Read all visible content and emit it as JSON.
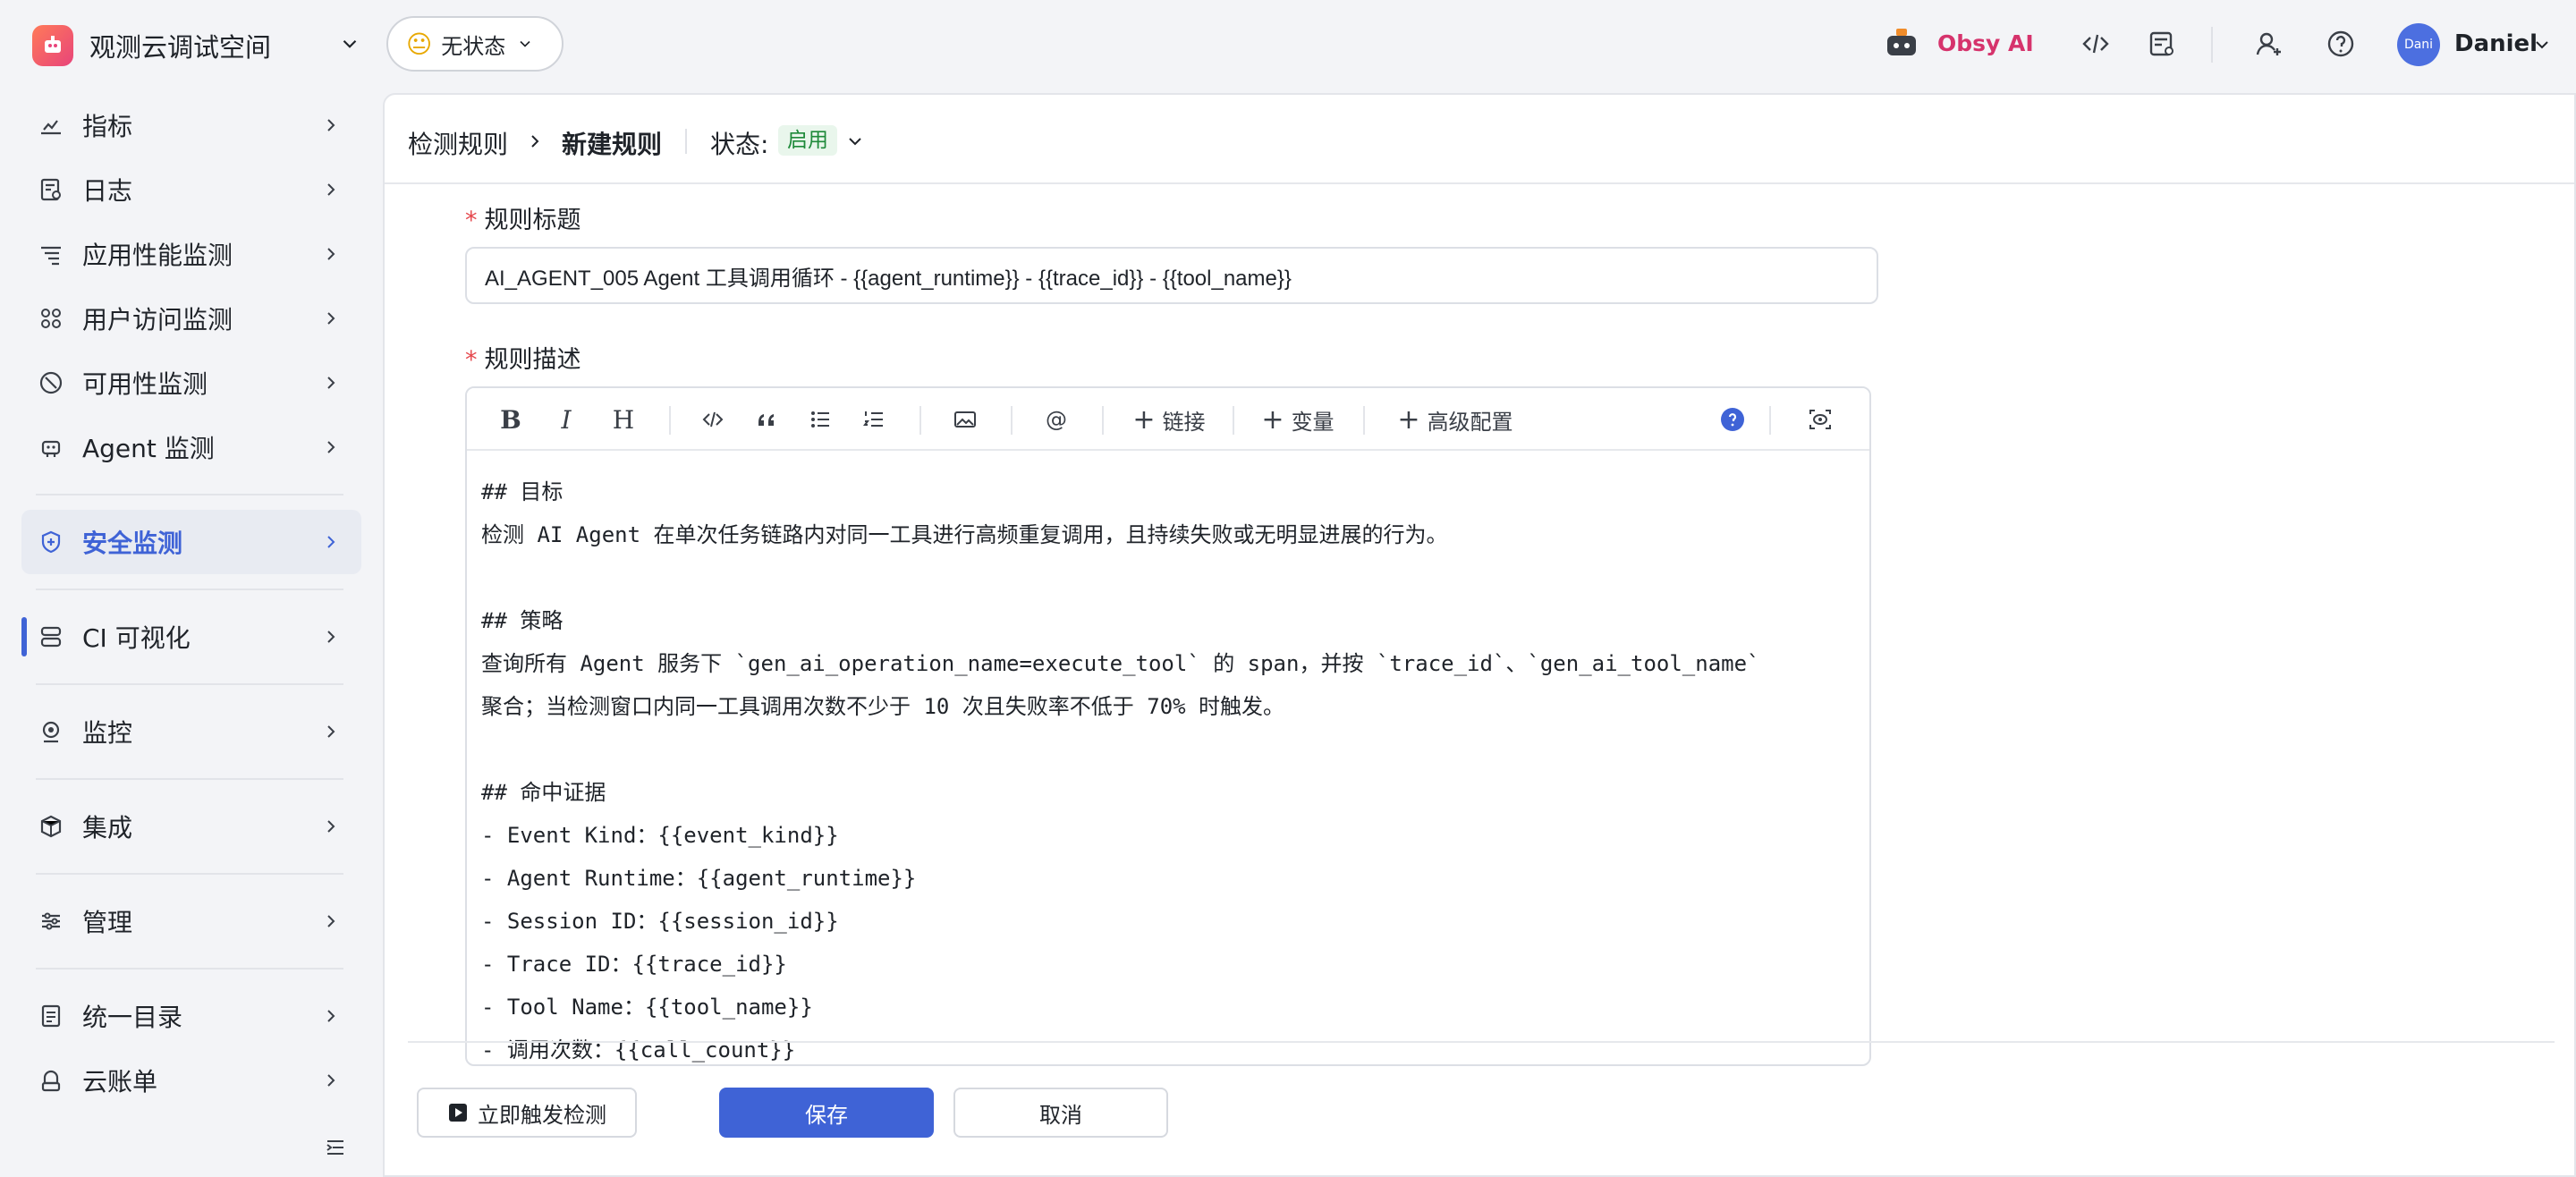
{
  "topbar": {
    "workspace_name": "观测云调试空间",
    "status_label": "无状态",
    "status_emoji": "😐",
    "ai_label": "Obsy AI",
    "avatar_text": "Dani",
    "user_name": "Daniel"
  },
  "sidebar": {
    "items": [
      {
        "label": "指标",
        "icon": "chart-icon"
      },
      {
        "label": "日志",
        "icon": "log-icon"
      },
      {
        "label": "应用性能监测",
        "icon": "apm-icon"
      },
      {
        "label": "用户访问监测",
        "icon": "grid-icon"
      },
      {
        "label": "可用性监测",
        "icon": "dial-icon"
      },
      {
        "label": "Agent 监测",
        "icon": "robot-icon"
      },
      {
        "label": "安全监测",
        "icon": "shield-icon",
        "active": true
      },
      {
        "label": "CI 可视化",
        "icon": "pipeline-icon"
      },
      {
        "label": "监控",
        "icon": "camera-icon"
      },
      {
        "label": "集成",
        "icon": "cube-icon"
      },
      {
        "label": "管理",
        "icon": "sliders-icon"
      },
      {
        "label": "统一目录",
        "icon": "catalog-icon"
      },
      {
        "label": "云账单",
        "icon": "bill-icon"
      }
    ]
  },
  "header": {
    "crumb_parent": "检测规则",
    "crumb_current": "新建规则",
    "state_label": "状态:",
    "state_value": "启用"
  },
  "form": {
    "title_label": "规则标题",
    "title_value": "AI_AGENT_005 Agent 工具调用循环 - {{agent_runtime}} - {{trace_id}} - {{tool_name}}",
    "desc_label": "规则描述",
    "toolbar": {
      "bold": "B",
      "italic": "I",
      "heading": "H",
      "mention": "@",
      "link": "链接",
      "variable": "变量",
      "advanced": "高级配置"
    },
    "content_lines": [
      "## 目标",
      "检测 AI Agent 在单次任务链路内对同一工具进行高频重复调用，且持续失败或无明显进展的行为。",
      "",
      "## 策略",
      "查询所有 Agent 服务下 `gen_ai_operation_name=execute_tool` 的 span，并按 `trace_id`、`gen_ai_tool_name`",
      "聚合；当检测窗口内同一工具调用次数不少于 10 次且失败率不低于 70% 时触发。",
      "",
      "## 命中证据",
      "- Event Kind：{{event_kind}}",
      "- Agent Runtime：{{agent_runtime}}",
      "- Session ID：{{session_id}}",
      "- Trace ID：{{trace_id}}",
      "- Tool Name：{{tool_name}}",
      "- 调用次数：{{call_count}}"
    ]
  },
  "footer": {
    "trigger_label": "立即触发检测",
    "save_label": "保存",
    "cancel_label": "取消"
  },
  "colors": {
    "primary": "#3f63d6",
    "ai_brand": "#d6336c",
    "enabled_badge": "#1f8a3a",
    "required": "#e5484d"
  }
}
